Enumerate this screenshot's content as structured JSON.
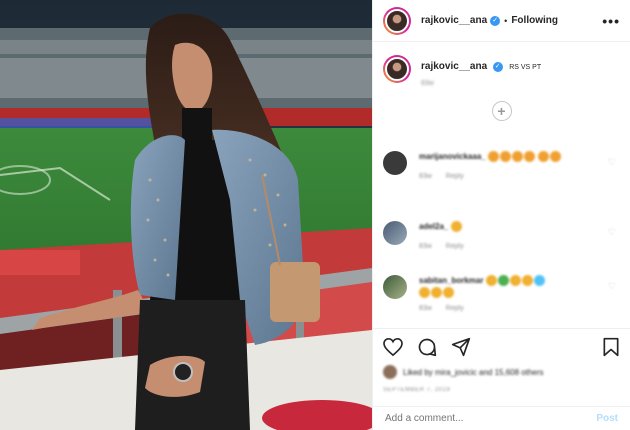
{
  "header": {
    "username": "rajkovic__ana",
    "separator": "•",
    "following_label": "Following",
    "more_label": "•••"
  },
  "caption": {
    "username": "rajkovic__ana",
    "text": "RS VS PT",
    "time": "83w"
  },
  "load_more_label": "+",
  "comments": [
    {
      "username": "marijanovickaaa_",
      "text": "❤",
      "time": "83w",
      "reply": "Reply",
      "emoji_colors": [
        "#f0a030",
        "#f0a030",
        "#f0a030",
        "#f0a030",
        "#f0a030",
        "#f0a030"
      ]
    },
    {
      "username": "adel2a_",
      "text": "😍",
      "time": "83w",
      "reply": "Reply",
      "emoji_colors": [
        "#f0b030"
      ]
    },
    {
      "username": "sabitan_borkmar",
      "text": "😍🔥",
      "time": "83w",
      "reply": "Reply",
      "emoji_colors": [
        "#f0b030",
        "#4caf50",
        "#f0b030",
        "#f0b030",
        "#4fc3f7",
        "#f0b030",
        "#f0b030",
        "#f0b030"
      ]
    }
  ],
  "actions": {
    "like_icon": "heart-icon",
    "comment_icon": "comment-icon",
    "share_icon": "share-icon",
    "save_icon": "bookmark-icon"
  },
  "likes_text": "Liked by mira_jovicic and 15,608 others",
  "date": "SEPTEMBER 7, 2019",
  "add_comment": {
    "placeholder": "Add a comment...",
    "post_label": "Post"
  },
  "colors": {
    "verified": "#3897f0",
    "post_disabled": "#b2dffc",
    "border": "#efefef"
  }
}
